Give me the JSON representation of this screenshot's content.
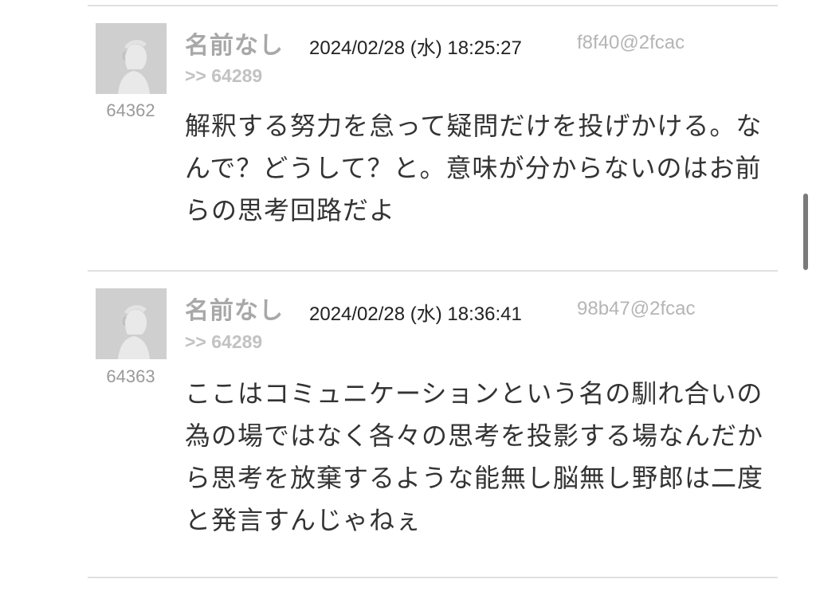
{
  "posts": [
    {
      "number": "64362",
      "name": "名前なし",
      "date": "2024/02/28 (水) 18:25:27",
      "uid": "f8f40@2fcac",
      "reply": ">> 64289",
      "body": "解釈する努力を怠って疑問だけを投げかける。なんで？どうして？と。意味が分からないのはお前らの思考回路だよ"
    },
    {
      "number": "64363",
      "name": "名前なし",
      "date": "2024/02/28 (水) 18:36:41",
      "uid": "98b47@2fcac",
      "reply": ">> 64289",
      "body": "ここはコミュニケーションという名の馴れ合いの為の場ではなく各々の思考を投影する場なんだから思考を放棄するような能無し脳無し野郎は二度と発言すんじゃねぇ"
    }
  ],
  "icons": {
    "avatar": "anonymous-user-avatar-icon"
  },
  "colors": {
    "name": "#a8a8a8",
    "uid": "#b5b5b5",
    "reply": "#c2c2c2",
    "avatar_bg": "#cfcfcf",
    "divider": "#e0e0e0"
  }
}
